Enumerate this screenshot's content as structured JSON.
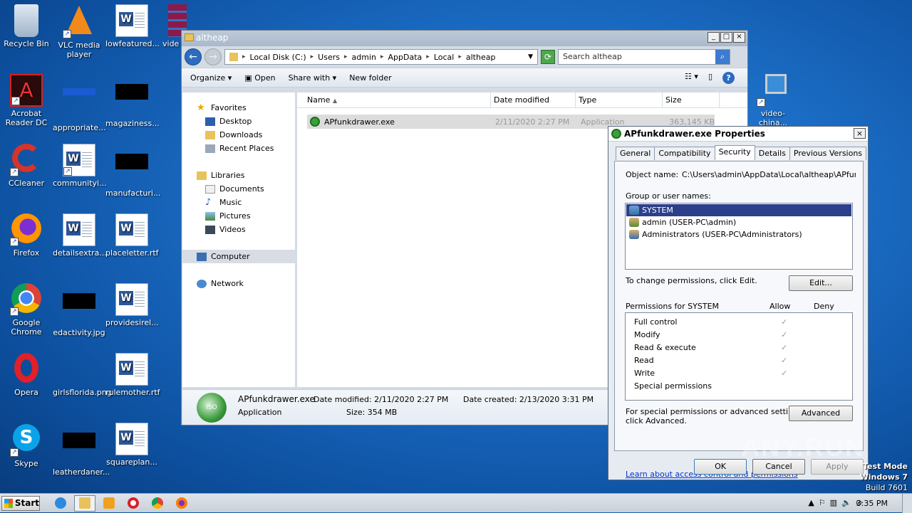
{
  "desktop_icons": [
    {
      "label": "Recycle Bin",
      "icon": "recycle-bin-icon"
    },
    {
      "label": "VLC media player",
      "icon": "vlc-icon"
    },
    {
      "label": "lowfeatured...",
      "icon": "word-doc-icon"
    },
    {
      "label": "vide",
      "icon": "winrar-icon"
    },
    {
      "label": "Acrobat Reader DC",
      "icon": "acrobat-icon"
    },
    {
      "label": "appropriate...",
      "icon": "file-icon"
    },
    {
      "label": "magaziness...",
      "icon": "file-icon"
    },
    {
      "label": "CCleaner",
      "icon": "ccleaner-icon"
    },
    {
      "label": "communityi...",
      "icon": "word-doc-icon"
    },
    {
      "label": "manufacturi...",
      "icon": "file-icon"
    },
    {
      "label": "Firefox",
      "icon": "firefox-icon"
    },
    {
      "label": "detailsextra...",
      "icon": "word-doc-icon"
    },
    {
      "label": "placeletter.rtf",
      "icon": "word-doc-icon"
    },
    {
      "label": "Google Chrome",
      "icon": "chrome-icon"
    },
    {
      "label": "edactivity.jpg",
      "icon": "file-icon"
    },
    {
      "label": "providesirel...",
      "icon": "word-doc-icon"
    },
    {
      "label": "Opera",
      "icon": "opera-icon"
    },
    {
      "label": "girlsflorida.png",
      "icon": "file-icon"
    },
    {
      "label": "rulemother.rtf",
      "icon": "word-doc-icon"
    },
    {
      "label": "Skype",
      "icon": "skype-icon"
    },
    {
      "label": "leatherdaner...",
      "icon": "file-icon"
    },
    {
      "label": "squareplan...",
      "icon": "word-doc-icon"
    },
    {
      "label": "video-china...",
      "icon": "installer-icon"
    }
  ],
  "explorer": {
    "title": "altheap",
    "breadcrumb": [
      "Local Disk (C:)",
      "Users",
      "admin",
      "AppData",
      "Local",
      "altheap"
    ],
    "search_placeholder": "Search altheap",
    "toolbar": {
      "organize": "Organize",
      "open": "Open",
      "share_with": "Share with",
      "new_folder": "New folder"
    },
    "nav": {
      "favorites": "Favorites",
      "desktop": "Desktop",
      "downloads": "Downloads",
      "recent": "Recent Places",
      "libraries": "Libraries",
      "documents": "Documents",
      "music": "Music",
      "pictures": "Pictures",
      "videos": "Videos",
      "computer": "Computer",
      "network": "Network"
    },
    "columns": {
      "name": "Name",
      "date": "Date modified",
      "type": "Type",
      "size": "Size"
    },
    "file": {
      "name": "APfunkdrawer.exe",
      "date": "2/11/2020 2:27 PM",
      "type": "Application",
      "size": "363,145 KB"
    },
    "details": {
      "name": "APfunkdrawer.exe",
      "type": "Application",
      "modified_label": "Date modified:",
      "modified": "2/11/2020 2:27 PM",
      "created_label": "Date created:",
      "created": "2/13/2020 3:31 PM",
      "size_label": "Size:",
      "size": "354 MB"
    }
  },
  "dialog": {
    "title": "APfunkdrawer.exe Properties",
    "tabs": [
      "General",
      "Compatibility",
      "Security",
      "Details",
      "Previous Versions"
    ],
    "object_label": "Object name:",
    "object_value": "C:\\Users\\admin\\AppData\\Local\\altheap\\APfunkd",
    "group_label": "Group or user names:",
    "users": [
      "SYSTEM",
      "admin (USER-PC\\admin)",
      "Administrators (USER-PC\\Administrators)"
    ],
    "change_text": "To change permissions, click Edit.",
    "edit": "Edit...",
    "perms_for": "Permissions for SYSTEM",
    "allow": "Allow",
    "deny": "Deny",
    "permissions": [
      "Full control",
      "Modify",
      "Read & execute",
      "Read",
      "Write",
      "Special permissions"
    ],
    "special_text_1": "For special permissions or advanced settings,",
    "special_text_2": "click Advanced.",
    "advanced": "Advanced",
    "learn_link": "Learn about access control and permissions",
    "ok": "OK",
    "cancel": "Cancel",
    "apply": "Apply"
  },
  "taskbar": {
    "start": "Start",
    "time": "3:35 PM"
  },
  "watermark": "ANY.RUN",
  "test_mode": [
    "Test Mode",
    "Windows 7",
    "Build 7601"
  ]
}
